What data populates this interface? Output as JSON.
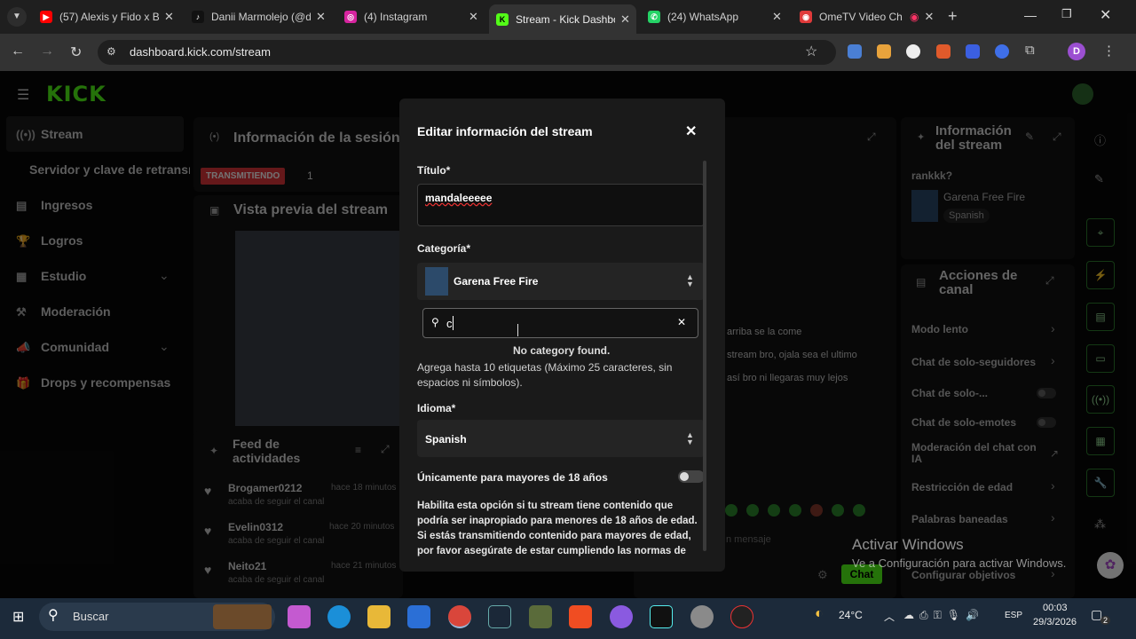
{
  "browser": {
    "tabs": [
      {
        "title": "(57) Alexis y Fido x Ba",
        "icon": "youtube-icon",
        "color": "#ff0000"
      },
      {
        "title": "Danii Marmolejo (@d",
        "icon": "tiktok-icon",
        "color": "#111111"
      },
      {
        "title": "(4) Instagram",
        "icon": "instagram-icon",
        "color": "#d6249f"
      },
      {
        "title": "Stream - Kick Dashbo",
        "icon": "kick-icon",
        "color": "#53fc18"
      },
      {
        "title": "(24) WhatsApp",
        "icon": "whatsapp-icon",
        "color": "#25d366"
      },
      {
        "title": "OmeTV Video Ch",
        "icon": "ometv-icon",
        "color": "#e03a3a"
      }
    ],
    "url": "dashboard.kick.com/stream",
    "profile_initial": "D"
  },
  "sidebar": {
    "logo": "KICK",
    "items": [
      {
        "label": "Stream"
      },
      {
        "label": "Servidor y clave de retransn"
      },
      {
        "label": "Ingresos"
      },
      {
        "label": "Logros"
      },
      {
        "label": "Estudio"
      },
      {
        "label": "Moderación"
      },
      {
        "label": "Comunidad"
      },
      {
        "label": "Drops y recompensas"
      }
    ]
  },
  "session": {
    "title": "Información de la sesión",
    "status": "TRANSMITIENDO",
    "viewers": "1"
  },
  "preview": {
    "title": "Vista previa del stream"
  },
  "feed": {
    "title_line1": "Feed de",
    "title_line2": "actividades",
    "items": [
      {
        "user": "Brogamer0212",
        "time": "hace 18 minutos",
        "action": "acaba de seguir el canal"
      },
      {
        "user": "Evelin0312",
        "time": "hace 20 minutos",
        "action": "acaba de seguir el canal"
      },
      {
        "user": "Neito21",
        "time": "hace 21 minutos",
        "action": "acaba de seguir el canal"
      }
    ]
  },
  "chat": {
    "messages": [
      "arriba se la come",
      "stream bro, ojala sea el ultimo",
      "así bro ni llegaras muy lejos"
    ],
    "input_placeholder": "n mensaje",
    "send_label": "Chat"
  },
  "stream_info": {
    "title_line1": "Información",
    "title_line2": "del stream",
    "stream_title": "rankkk?",
    "category": "Garena Free Fire",
    "language": "Spanish"
  },
  "channel_actions": {
    "title_line1": "Acciones de",
    "title_line2": "canal",
    "items": [
      {
        "label": "Modo lento",
        "kind": "chevron"
      },
      {
        "label": "Chat de solo-seguidores",
        "kind": "chevron"
      },
      {
        "label": "Chat de solo-...",
        "kind": "toggle"
      },
      {
        "label": "Chat de solo-emotes",
        "kind": "toggle"
      },
      {
        "label": "Moderación del chat con IA",
        "kind": "link"
      },
      {
        "label": "Restricción de edad",
        "kind": "chevron"
      },
      {
        "label": "Palabras baneadas",
        "kind": "chevron"
      },
      {
        "label": "Configurar objetivos",
        "kind": "chevron"
      }
    ]
  },
  "modal": {
    "heading": "Editar información del stream",
    "title_label": "Título*",
    "title_value": "mandaleeeee",
    "category_label": "Categoría*",
    "category_value": "Garena Free Fire",
    "search_value": "c",
    "no_results": "No category found.",
    "tags_help": "Agrega hasta 10 etiquetas (Máximo 25 caracteres, sin espacios ni símbolos).",
    "language_label": "Idioma*",
    "language_value": "Spanish",
    "adult_label": "Únicamente para mayores de 18 años",
    "adult_help": "Habilita esta opción si tu stream tiene contenido que podría ser inapropiado para menores de 18 años de edad. Si estás transmitiendo contenido para mayores de edad, por favor asegúrate de estar cumpliendo las normas de"
  },
  "watermark": {
    "line1": "Activar Windows",
    "line2": "Ve a Configuración para activar Windows."
  },
  "taskbar": {
    "search_label": "Buscar",
    "weather": "24°C",
    "language": "ESP",
    "time": "00:03",
    "date": "29/3/2026",
    "notifications": "2"
  },
  "colors": {
    "accent": "#53fc18",
    "modal_bg": "#1a1a1a",
    "live_badge": "#e0353a"
  }
}
